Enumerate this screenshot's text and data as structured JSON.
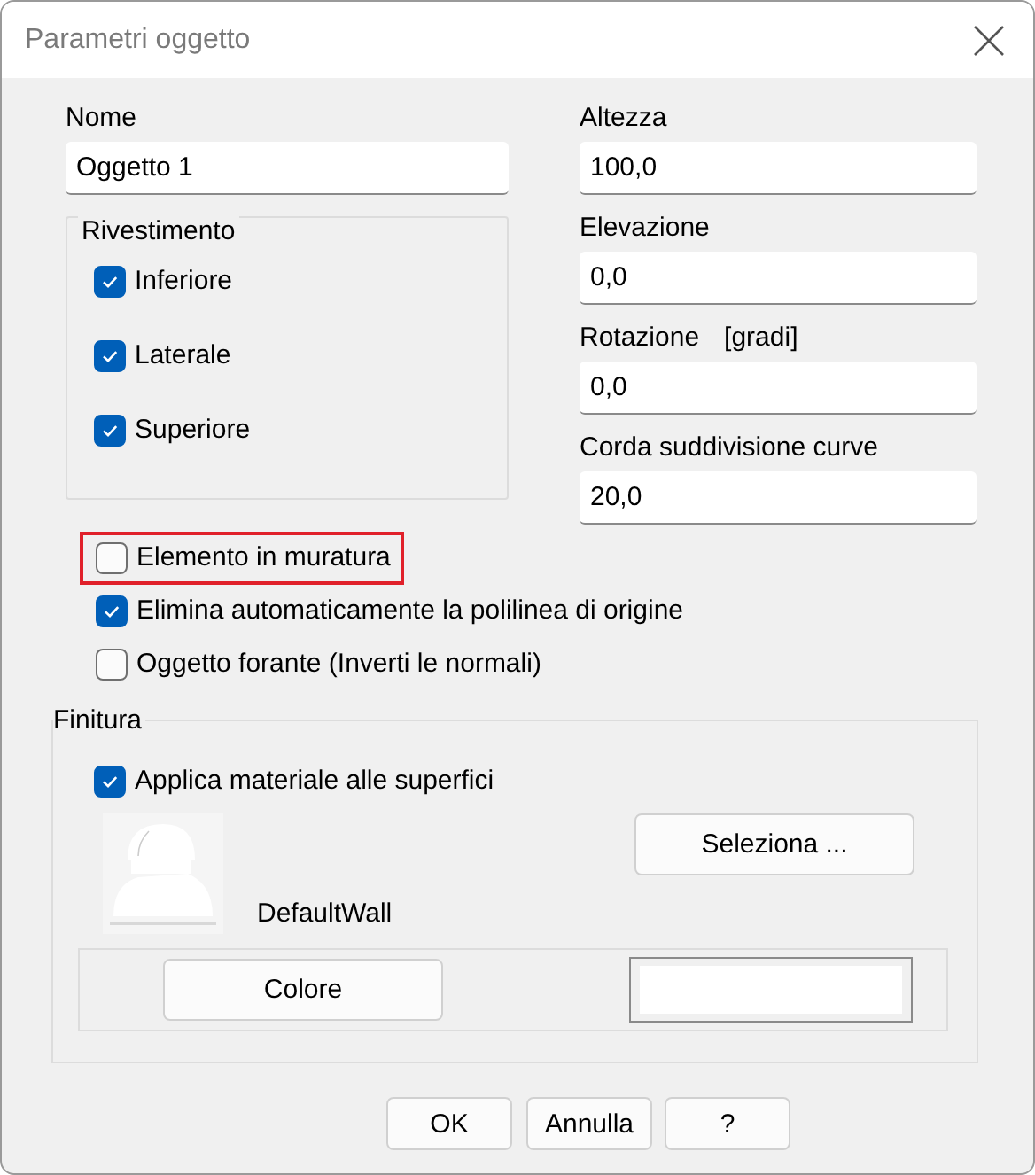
{
  "window": {
    "title": "Parametri oggetto"
  },
  "name": {
    "label": "Nome",
    "value": "Oggetto 1"
  },
  "covering": {
    "title": "Rivestimento",
    "options": [
      {
        "label": "Inferiore",
        "checked": true
      },
      {
        "label": "Laterale",
        "checked": true
      },
      {
        "label": "Superiore",
        "checked": true
      }
    ]
  },
  "fields": [
    {
      "label": "Altezza",
      "value": "100,0"
    },
    {
      "label": "Elevazione",
      "value": "0,0"
    },
    {
      "label": "Rotazione",
      "unit": "[gradi]",
      "value": "0,0"
    },
    {
      "label": "Corda suddivisione curve",
      "value": "20,0"
    }
  ],
  "options": [
    {
      "label": "Elemento in muratura",
      "checked": false,
      "highlighted": true
    },
    {
      "label": "Elimina automaticamente la polilinea di origine",
      "checked": true,
      "highlighted": false
    },
    {
      "label": "Oggetto forante (Inverti le normali)",
      "checked": false,
      "highlighted": false
    }
  ],
  "finish": {
    "title": "Finitura",
    "apply": {
      "label": "Applica materiale alle superfici",
      "checked": true
    },
    "material": {
      "name": "DefaultWall",
      "kind": "picture"
    },
    "select_button": "Seleziona ...",
    "color_button": "Colore",
    "color": "#ffffff"
  },
  "buttons": [
    "OK",
    "Annulla",
    "?"
  ]
}
